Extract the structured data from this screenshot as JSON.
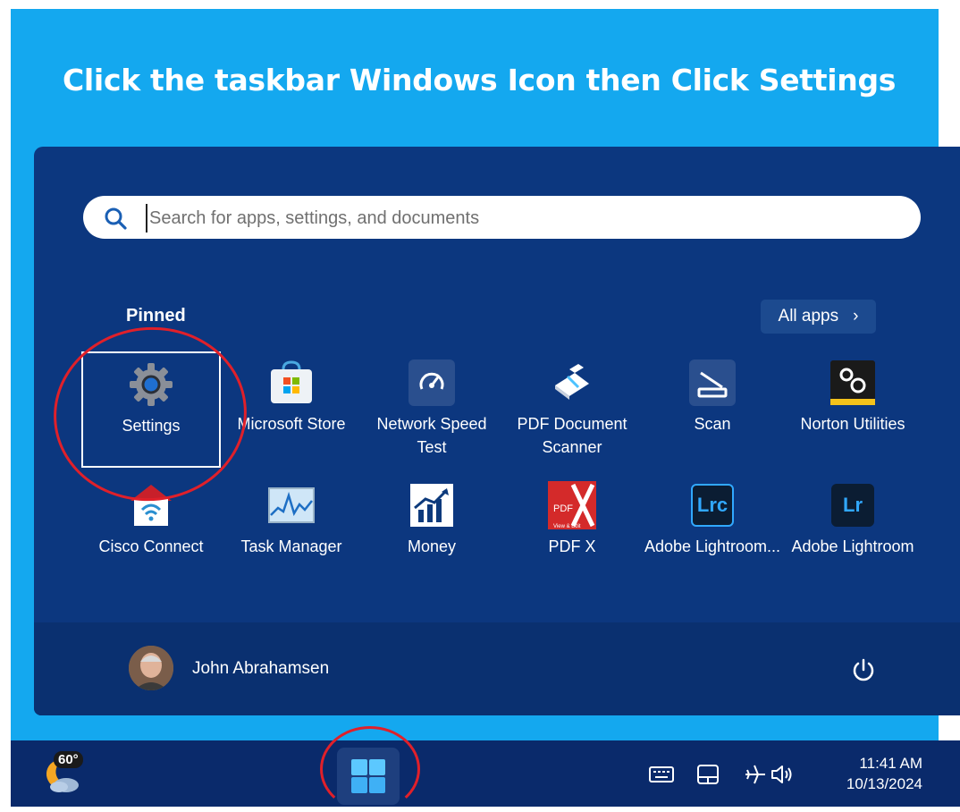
{
  "instruction": "Click the taskbar Windows Icon then Click Settings",
  "search": {
    "placeholder": "Search for apps, settings, and documents"
  },
  "pinned": {
    "label": "Pinned",
    "all_apps": "All apps"
  },
  "apps": [
    {
      "label": "Settings",
      "icon": "settings-gear-icon"
    },
    {
      "label": "Microsoft Store",
      "icon": "microsoft-store-icon"
    },
    {
      "label": "Network Speed Test",
      "icon": "speedometer-icon"
    },
    {
      "label": "PDF Document Scanner",
      "icon": "scanner-icon"
    },
    {
      "label": "Scan",
      "icon": "scan-icon"
    },
    {
      "label": "Norton Utilities",
      "icon": "norton-utilities-icon"
    },
    {
      "label": "Cisco Connect",
      "icon": "cisco-connect-icon"
    },
    {
      "label": "Task Manager",
      "icon": "task-manager-icon"
    },
    {
      "label": "Money",
      "icon": "money-chart-icon"
    },
    {
      "label": "PDF X",
      "icon": "pdf-x-icon",
      "icon_text": "PDF",
      "icon_subtext": "View & Edit"
    },
    {
      "label": "Adobe Lightroom...",
      "icon": "lightroom-classic-icon",
      "icon_text": "Lrc"
    },
    {
      "label": "Adobe Lightroom",
      "icon": "lightroom-icon",
      "icon_text": "Lr"
    }
  ],
  "user": {
    "name": "John Abrahamsen"
  },
  "taskbar": {
    "weather_temp": "60°",
    "time": "11:41 AM",
    "date": "10/13/2024"
  },
  "colors": {
    "background": "#14a8ef",
    "start_menu": "#0c377f",
    "taskbar": "#0a2a6b",
    "annotation": "#e0202a"
  }
}
